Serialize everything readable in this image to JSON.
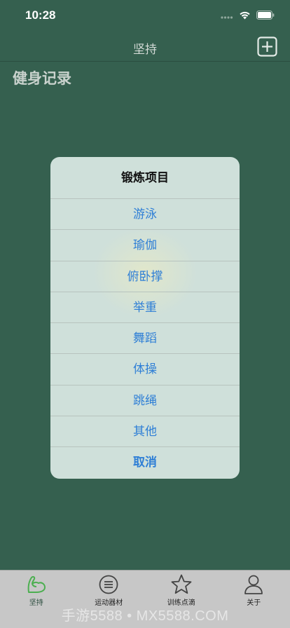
{
  "status_bar": {
    "time": "10:28"
  },
  "nav": {
    "title": "坚持"
  },
  "section": {
    "title": "健身记录"
  },
  "dialog": {
    "title": "锻炼项目",
    "options": [
      "游泳",
      "瑜伽",
      "俯卧撑",
      "举重",
      "舞蹈",
      "体操",
      "跳绳",
      "其他"
    ],
    "cancel_label": "取消"
  },
  "tab_bar": {
    "tabs": [
      {
        "label": "坚持",
        "icon": "arm-icon",
        "active": true
      },
      {
        "label": "运动器材",
        "icon": "list-circle-icon",
        "active": false
      },
      {
        "label": "训练点滴",
        "icon": "star-icon",
        "active": false
      },
      {
        "label": "关于",
        "icon": "person-icon",
        "active": false
      }
    ]
  },
  "watermark": "手游5588 • MX5588.COM",
  "colors": {
    "background": "#35604f",
    "dialog_background": "#cfe0da",
    "option_text": "#2f7fd6",
    "tab_bar_background": "#c7c7c7",
    "active_tab_icon": "#4caf50"
  }
}
